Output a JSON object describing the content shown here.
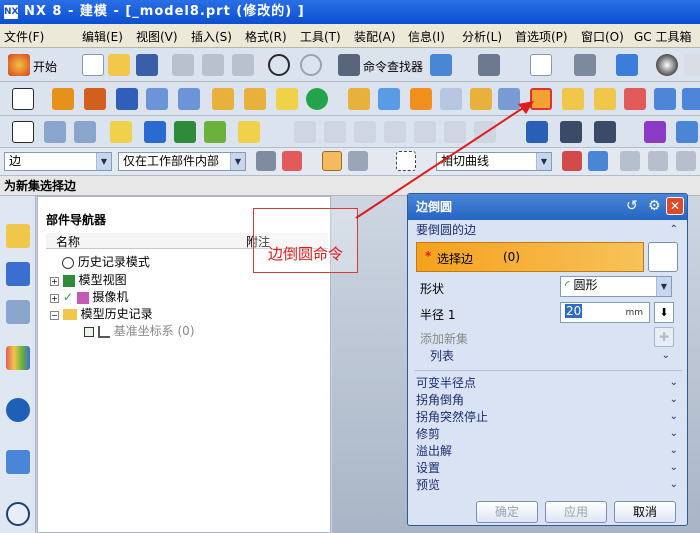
{
  "window": {
    "title": "NX 8 - 建模 - [_model8.prt  (修改的)  ]",
    "logo": "NX"
  },
  "menu": [
    "文件(F)",
    "编辑(E)",
    "视图(V)",
    "插入(S)",
    "格式(R)",
    "工具(T)",
    "装配(A)",
    "信息(I)",
    "分析(L)",
    "首选项(P)",
    "窗口(O)",
    "GC 工具箱"
  ],
  "toolbar": {
    "start_label": "开始",
    "finder_label": "命令查找器"
  },
  "selection_bar": {
    "filter_type": "边",
    "scope": "仅在工作部件内部",
    "curve_rule": "相切曲线"
  },
  "prompt": "为新集选择边",
  "navigator": {
    "title": "部件导航器",
    "col_name": "名称",
    "col_note": "附注",
    "items": [
      "历史记录模式",
      "模型视图",
      "摄像机",
      "模型历史记录"
    ],
    "sub_item": "基准坐标系",
    "sub_count": "(0)"
  },
  "annotation": "边倒圆命令",
  "dialog": {
    "title": "边倒圆",
    "section_edges": "要倒圆的边",
    "select_edge": "选择边",
    "select_count": "(0)",
    "shape_label": "形状",
    "shape_value": "圆形",
    "radius_label": "半径 1",
    "radius_value": "20",
    "radius_unit": "mm",
    "add_new_set": "添加新集",
    "list": "列表",
    "sections": [
      "可变半径点",
      "拐角倒角",
      "拐角突然停止",
      "修剪",
      "溢出解",
      "设置",
      "预览"
    ],
    "ok": "确定",
    "apply": "应用",
    "cancel": "取消"
  },
  "colors": {
    "accent": "#e98a12",
    "title_blue": "#2566c3",
    "annotation": "#e01b1b"
  }
}
